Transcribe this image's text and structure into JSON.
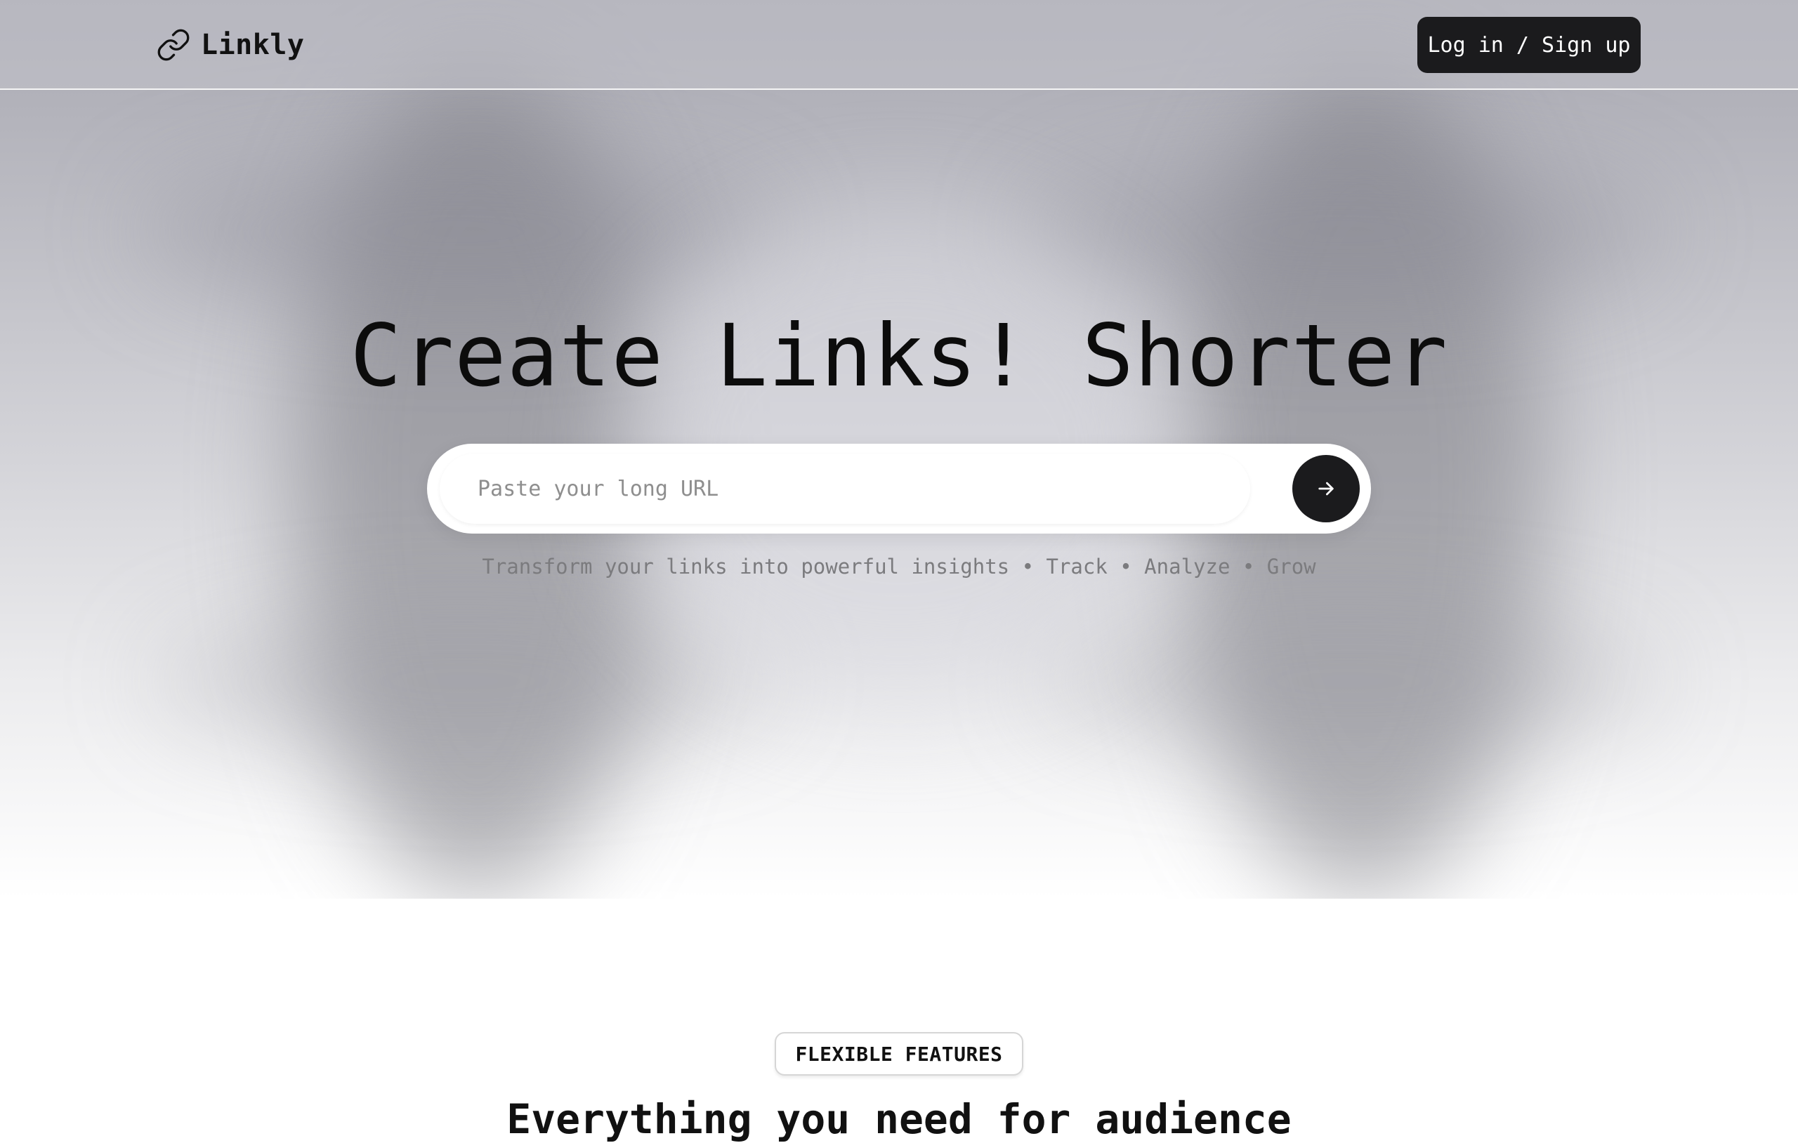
{
  "header": {
    "brand_name": "Linkly",
    "login_label": "Log in / Sign up"
  },
  "hero": {
    "title": "Create Links! Shorter",
    "url_placeholder": "Paste your long URL",
    "tagline": "Transform your links into powerful insights • Track • Analyze • Grow"
  },
  "features": {
    "badge": "FLEXIBLE FEATURES",
    "title": "Everything you need for audience"
  },
  "icons": {
    "brand": "link-icon",
    "submit": "arrow-right-icon"
  },
  "colors": {
    "primary_button": "#1b1b1d",
    "title_text": "#0c0c0c",
    "tagline_text": "#7b7b7e"
  }
}
